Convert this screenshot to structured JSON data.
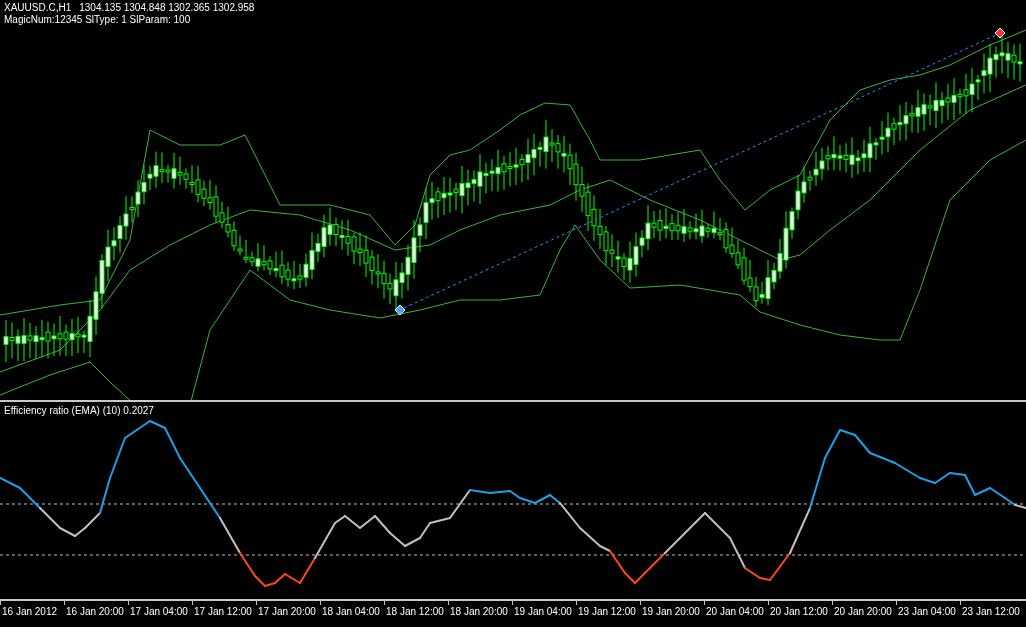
{
  "chart": {
    "symbol": "XAUUSD.C,H1",
    "quotes": "1304.135 1304.848 1302.365 1302.958",
    "expert_info": "MagicNum:12345 SlType: 1 SlParam: 100"
  },
  "indicator": {
    "title": "Efficiency ratio (EMA) (10) 0.2027"
  },
  "time_axis": {
    "labels": [
      "16 Jan 2012",
      "16 Jan 20:00",
      "17 Jan 04:00",
      "17 Jan 12:00",
      "17 Jan 20:00",
      "18 Jan 04:00",
      "18 Jan 12:00",
      "18 Jan 20:00",
      "19 Jan 04:00",
      "19 Jan 12:00",
      "19 Jan 20:00",
      "20 Jan 04:00",
      "20 Jan 12:00",
      "20 Jan 20:00",
      "23 Jan 04:00",
      "23 Jan 12:00"
    ]
  }
}
